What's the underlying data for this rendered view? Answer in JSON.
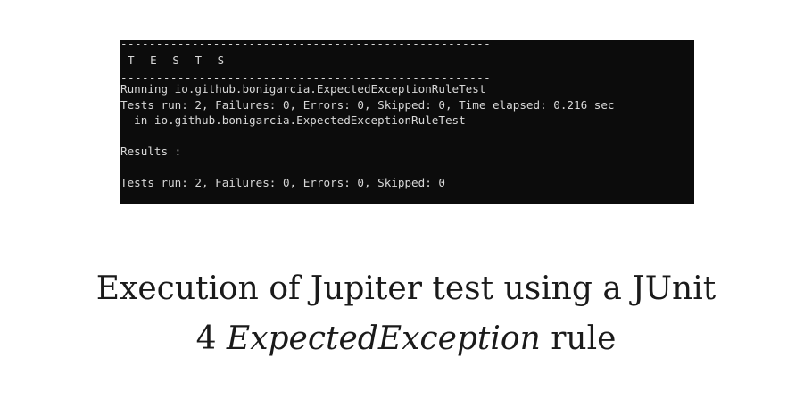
{
  "console": {
    "separator_top": "----------------------------------------------------",
    "section_title": "T E S T S",
    "separator_bottom": "----------------------------------------------------",
    "lines": [
      "Running io.github.bonigarcia.ExpectedExceptionRuleTest",
      "Tests run: 2, Failures: 0, Errors: 0, Skipped: 0, Time elapsed: 0.216 sec",
      "- in io.github.bonigarcia.ExpectedExceptionRuleTest",
      "",
      "Results :",
      "",
      "Tests run: 2, Failures: 0, Errors: 0, Skipped: 0"
    ],
    "background_color": "#0c0c0c",
    "text_color": "#d8d8d8"
  },
  "caption": {
    "line1": "Execution of Jupiter test using a JUnit",
    "line2_prefix": "4 ",
    "line2_italic": "ExpectedException",
    "line2_suffix": " rule"
  }
}
